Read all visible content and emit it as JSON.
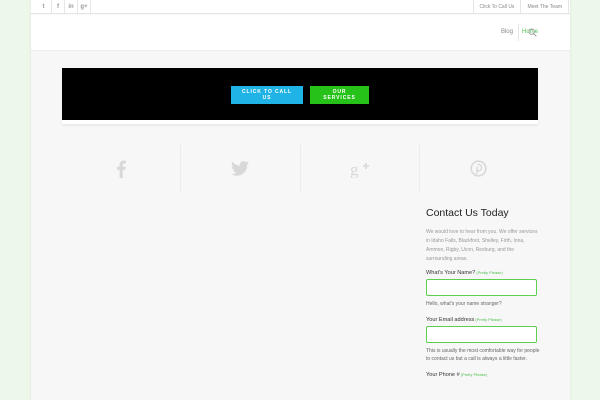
{
  "topbar": {
    "social_icons": [
      "twitter-icon",
      "facebook-icon",
      "linkedin-icon",
      "google-plus-icon"
    ],
    "social_glyphs": [
      "t",
      "f",
      "in",
      "g+"
    ],
    "links": [
      "Click To Call Us",
      "Meet The Team"
    ]
  },
  "nav": {
    "items": [
      "Blog",
      "Home"
    ],
    "active": "Home"
  },
  "hero": {
    "call_label": "CLICK TO CALL US",
    "services_label": "OUR SERVICES"
  },
  "social_share": [
    "facebook-icon",
    "twitter-icon",
    "google-plus-icon",
    "pinterest-icon"
  ],
  "contact": {
    "title": "Contact Us Today",
    "intro": "We would love to hear from you. We offer services in Idaho Falls, Blackfoot, Shelley, Firth, Iona, Ammon, Rigby, Ucon, Rexburg, and the surrounding areas.",
    "required_note": "(Pretty Please)",
    "fields": [
      {
        "label": "What's Your Name?",
        "value": "",
        "help": "Hello, what's your name stranger?"
      },
      {
        "label": "Your Email address",
        "value": "",
        "help": "This is usually the most comfortable way for people to contact us but a call is always a little faster."
      },
      {
        "label": "Your Phone #",
        "value": "",
        "help": ""
      }
    ]
  },
  "colors": {
    "accent_green": "#4fc14f",
    "call_blue": "#20b3e6",
    "services_green": "#26c219"
  }
}
